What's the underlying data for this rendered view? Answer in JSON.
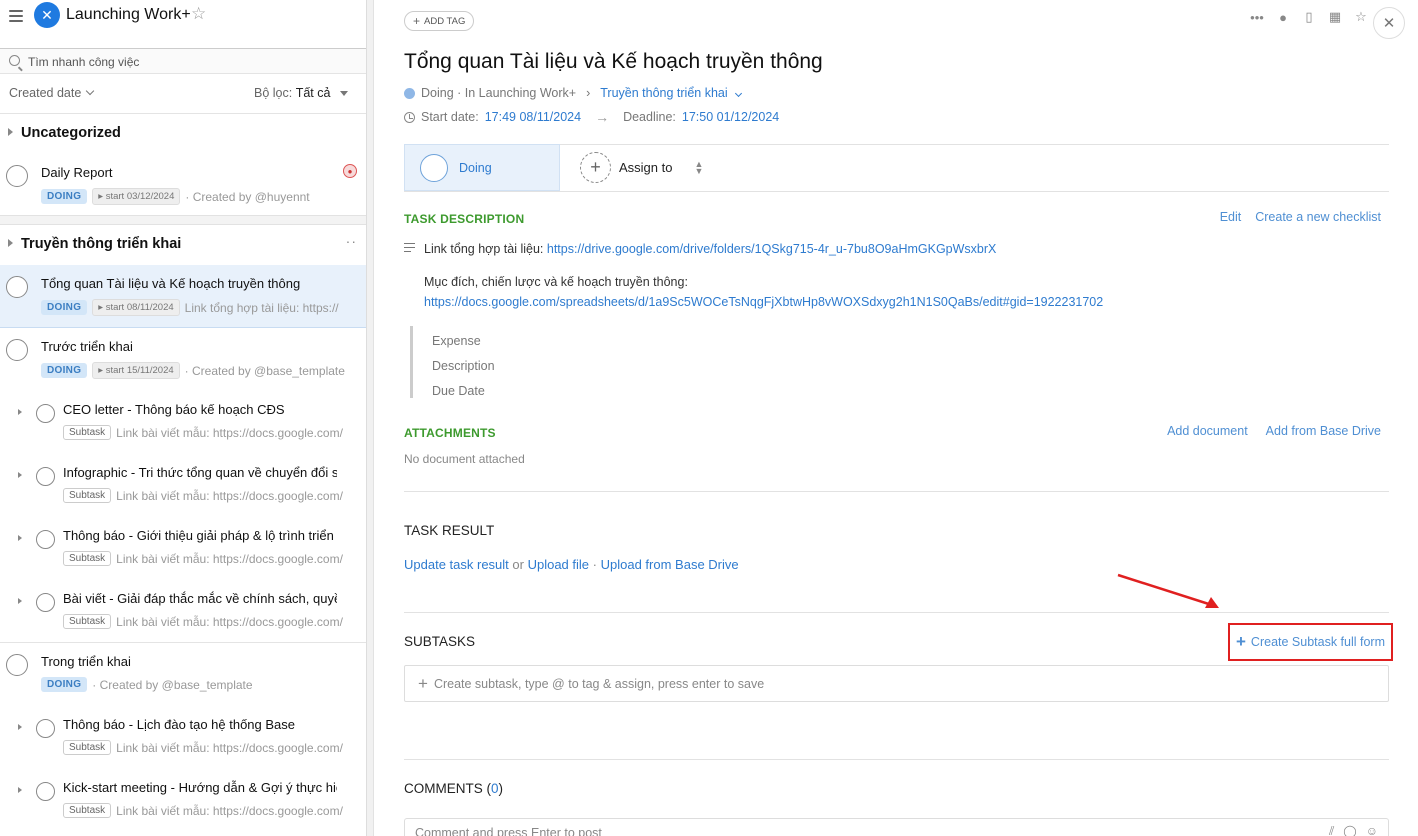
{
  "colors": {
    "accent": "#2e7bcf",
    "green_label": "#3d9a2e",
    "highlight_red": "#e02020",
    "selected_bg": "#e8f1fb"
  },
  "sidebar": {
    "app_title": "Launching Work+",
    "search_placeholder": "Tìm nhanh công việc",
    "sort_label": "Created date",
    "filter_label": "Bộ lọc:",
    "filter_value": "Tất cả",
    "groups": [
      {
        "title": "Uncategorized"
      },
      {
        "title": "Truyền thông triển khai"
      }
    ],
    "tasks": [
      {
        "title": "Daily Report",
        "badge": "DOING",
        "start": "start 03/12/2024",
        "meta": "· Created by @huyennt"
      },
      {
        "title": "Tổng quan Tài liệu và Kế hoạch truyền thông",
        "badge": "DOING",
        "start": "start 08/11/2024",
        "meta": "Link tổng hợp tài liệu: https://"
      },
      {
        "title": "Trước triển khai",
        "badge": "DOING",
        "start": "start 15/11/2024",
        "meta": "· Created by @base_template"
      },
      {
        "title": "CEO letter - Thông báo kế hoạch CĐS",
        "badge": "Subtask",
        "meta": "Link bài viết mẫu: https://docs.google.com/"
      },
      {
        "title": "Infographic - Tri thức tổng quan về chuyển đổi s",
        "badge": "Subtask",
        "meta": "Link bài viết mẫu: https://docs.google.com/"
      },
      {
        "title": "Thông báo - Giới thiệu giải pháp & lộ trình triển k",
        "badge": "Subtask",
        "meta": "Link bài viết mẫu: https://docs.google.com/"
      },
      {
        "title": "Bài viết - Giải đáp thắc mắc về chính sách, quyề",
        "badge": "Subtask",
        "meta": "Link bài viết mẫu: https://docs.google.com/"
      },
      {
        "title": "Trong triển khai",
        "badge": "DOING",
        "meta": "· Created by @base_template"
      },
      {
        "title": "Thông báo - Lịch đào tạo hệ thống Base",
        "badge": "Subtask",
        "meta": "Link bài viết mẫu: https://docs.google.com/"
      },
      {
        "title": "Kick-start meeting - Hướng dẫn & Gợi ý thực hiệ",
        "badge": "Subtask",
        "meta": "Link bài viết mẫu: https://docs.google.com/"
      }
    ]
  },
  "detail": {
    "add_tag": "ADD TAG",
    "title": "Tổng quan Tài liệu và Kế hoạch truyền thông",
    "status_text": "Doing · In Launching Work+",
    "breadcrumb_sep": "›",
    "group_link": "Truyền thông triển khai",
    "start_label": "Start date:",
    "start_value": "17:49 08/11/2024",
    "deadline_label": "Deadline:",
    "deadline_value": "17:50 01/12/2024",
    "status_box_label": "Doing",
    "assign_label": "Assign to",
    "desc_heading": "TASK DESCRIPTION",
    "desc_edit": "Edit",
    "desc_checklist": "Create a new checklist",
    "desc_line1_label": "Link tổng hợp tài liệu:",
    "desc_line1_url": "https://drive.google.com/drive/folders/1QSkg715-4r_u-7bu8O9aHmGKGpWsxbrX",
    "desc_line2_label": "Mục đích, chiến lược và kế hoạch truyền thông:",
    "desc_line2_url": "https://docs.google.com/spreadsheets/d/1a9Sc5WOCeTsNqgFjXbtwHp8vWOXSdxyg2h1N1S0QaBs/edit#gid=1922231702",
    "quote_items": [
      "Expense",
      "Description",
      "Due Date"
    ],
    "attach_heading": "ATTACHMENTS",
    "attach_add_doc": "Add document",
    "attach_add_drive": "Add from Base Drive",
    "attach_empty": "No document attached",
    "result_heading": "TASK RESULT",
    "result_update": "Update task result",
    "result_or": "or",
    "result_upload": "Upload file",
    "result_dot": "·",
    "result_drive": "Upload from Base Drive",
    "subtasks_heading": "SUBTASKS",
    "subtask_full_form": "Create Subtask full form",
    "subtask_placeholder": "Create subtask, type @ to tag & assign, press enter to save",
    "comments_heading": "COMMENTS",
    "comments_count": "0",
    "comment_placeholder": "Comment and press Enter to post"
  }
}
